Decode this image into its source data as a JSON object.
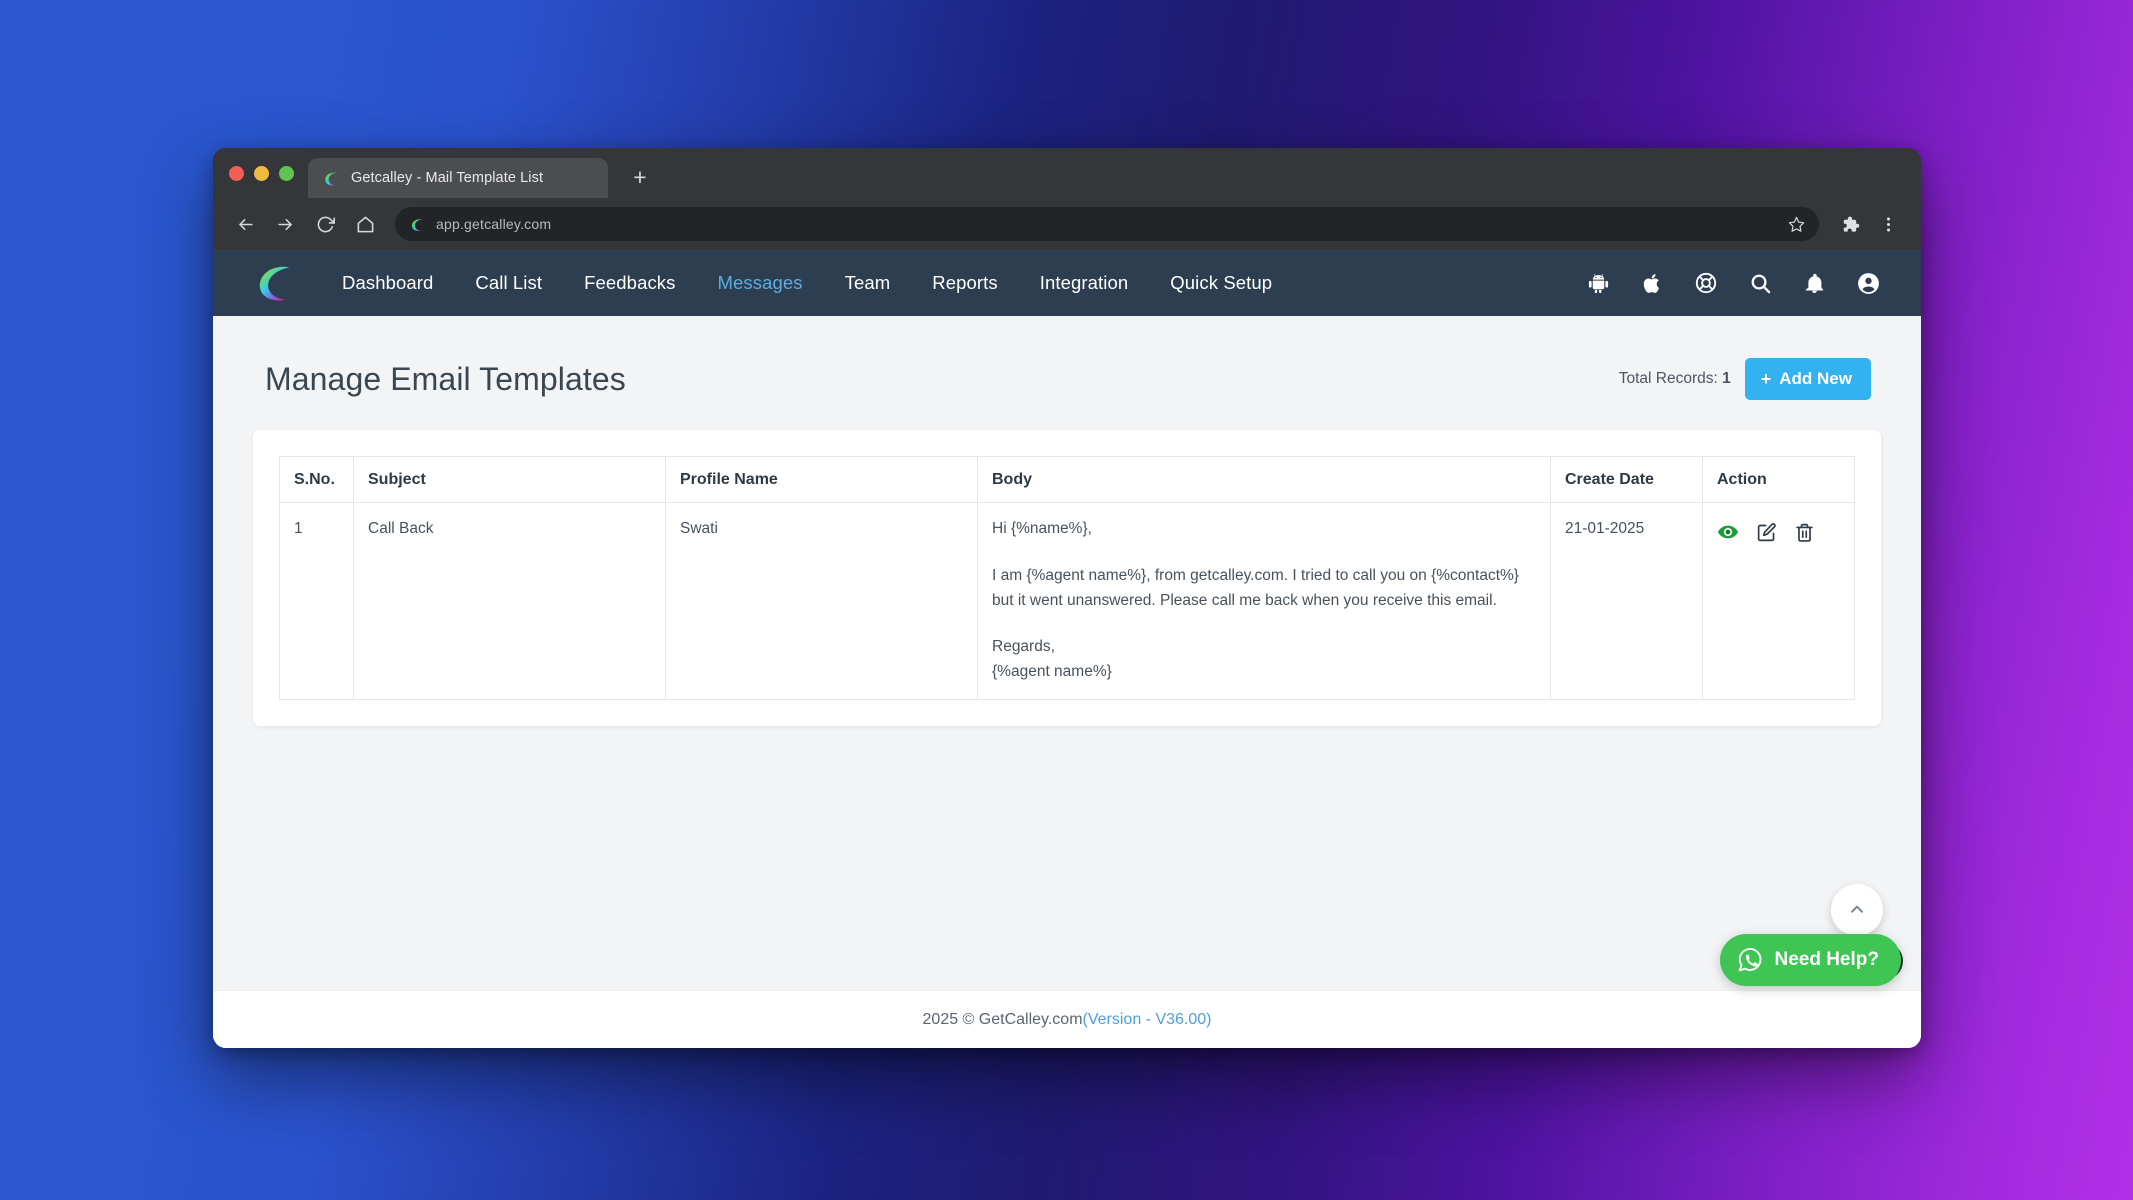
{
  "browser": {
    "tab": {
      "title": "Getcalley - Mail Template List",
      "favicon_name": "calley-logo-icon"
    },
    "new_tab_label": "+",
    "url": "app.getcalley.com",
    "toolbar_icons": [
      "back-icon",
      "forward-icon",
      "reload-icon",
      "home-icon",
      "bookmark-star-icon",
      "extensions-puzzle-icon",
      "browser-menu-icon"
    ]
  },
  "app_nav": {
    "logo_name": "calley-logo",
    "links": [
      {
        "label": "Dashboard",
        "active": false
      },
      {
        "label": "Call List",
        "active": false
      },
      {
        "label": "Feedbacks",
        "active": false
      },
      {
        "label": "Messages",
        "active": true
      },
      {
        "label": "Team",
        "active": false
      },
      {
        "label": "Reports",
        "active": false
      },
      {
        "label": "Integration",
        "active": false
      },
      {
        "label": "Quick Setup",
        "active": false
      }
    ],
    "right_icons": [
      "android-icon",
      "apple-icon",
      "support-icon",
      "search-icon",
      "notification-bell-icon",
      "user-account-icon"
    ],
    "active_color": "#5dade2",
    "background_color": "#2c3e50"
  },
  "page": {
    "title": "Manage Email Templates",
    "total_records_label": "Total Records:",
    "total_records_value": "1",
    "add_new_label": "Add New",
    "add_new_plus": "+",
    "accent_color": "#32b2f0"
  },
  "table": {
    "headers": [
      "S.No.",
      "Subject",
      "Profile Name",
      "Body",
      "Create Date",
      "Action"
    ],
    "rows": [
      {
        "sno": "1",
        "subject": "Call Back",
        "profile_name": "Swati",
        "body_line_1": "Hi {%name%},",
        "body_line_2": "I am {%agent name%}, from getcalley.com. I tried to call you on {%contact%} but it went unanswered. Please call me back when you receive this email.",
        "body_line_3": "Regards,",
        "body_line_4": "{%agent name%}",
        "create_date": "21-01-2025",
        "actions": [
          "view-icon",
          "edit-icon",
          "delete-icon"
        ]
      }
    ]
  },
  "footer": {
    "copyright": "2025 © GetCalley.com ",
    "version": "(Version - V36.00)",
    "version_color": "#4e9ee0"
  },
  "widgets": {
    "scroll_top_name": "scroll-to-top-button",
    "whatsapp_help_label": "Need Help?",
    "whatsapp_color": "#3fc554"
  }
}
